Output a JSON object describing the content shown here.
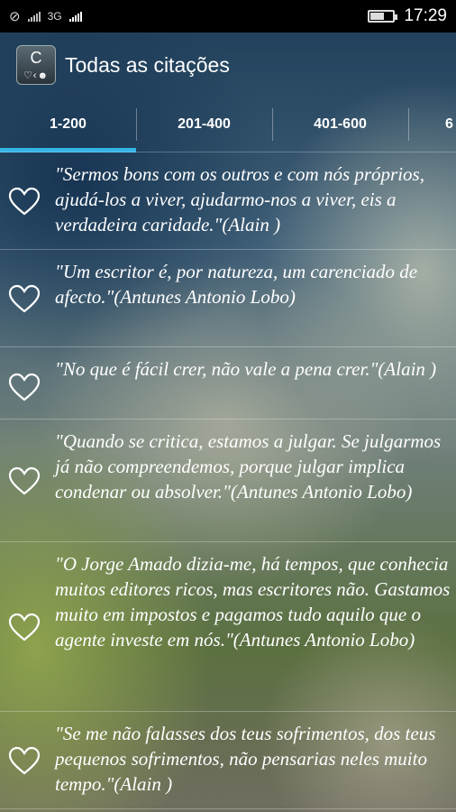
{
  "status_bar": {
    "network": "3G",
    "time": "17:29"
  },
  "app_bar": {
    "icon_letter": "C",
    "title": "Todas as citações"
  },
  "tabs": [
    {
      "label": "1-200",
      "selected": true
    },
    {
      "label": "201-400",
      "selected": false
    },
    {
      "label": "401-600",
      "selected": false
    },
    {
      "label": "6",
      "selected": false
    }
  ],
  "quotes": [
    {
      "text": "\"Sermos bons com os outros e com nós próprios, ajudá-los a viver, ajudarmo-nos a viver, eis a verdadeira caridade.\"(Alain )",
      "favorite": false
    },
    {
      "text": "\"Um escritor é, por natureza, um carenciado de afecto.\"(Antunes Antonio Lobo)",
      "favorite": false
    },
    {
      "text": "\"No que é fácil crer, não vale a pena crer.\"(Alain )",
      "favorite": false
    },
    {
      "text": "\"Quando se critica, estamos a julgar. Se julgarmos já não compreendemos, porque julgar implica condenar ou absolver.\"(Antunes Antonio Lobo)",
      "favorite": false
    },
    {
      "text": "\"O Jorge Amado dizia-me, há tempos, que conhecia muitos editores ricos, mas escritores não. Gastamos muito em impostos e pagamos tudo aquilo que o agente investe em nós.\"(Antunes Antonio Lobo)",
      "favorite": false
    },
    {
      "text": "\"Se me não falasses dos teus sofrimentos, dos teus pequenos sofrimentos, não pensarias neles muito tempo.\"(Alain )",
      "favorite": false
    }
  ],
  "colors": {
    "tab_indicator": "#33b5e5",
    "status_bar_bg": "#000000"
  },
  "icons": {
    "list_item": "heart-outline-icon"
  }
}
